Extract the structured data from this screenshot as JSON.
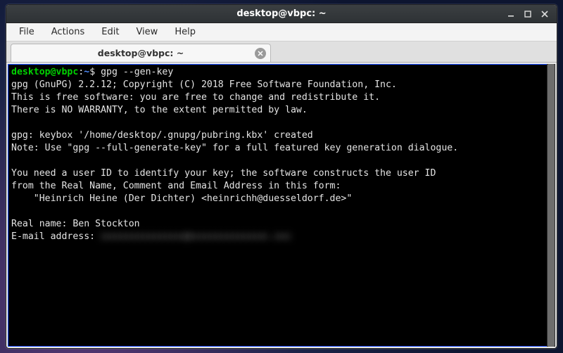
{
  "window": {
    "title": "desktop@vbpc: ~"
  },
  "menubar": {
    "items": [
      "File",
      "Actions",
      "Edit",
      "View",
      "Help"
    ]
  },
  "tab": {
    "label": "desktop@vbpc: ~"
  },
  "prompt": {
    "user_host": "desktop@vbpc",
    "colon": ":",
    "path": "~",
    "dollar": "$"
  },
  "terminal": {
    "command": " gpg --gen-key",
    "line1": "gpg (GnuPG) 2.2.12; Copyright (C) 2018 Free Software Foundation, Inc.",
    "line2": "This is free software: you are free to change and redistribute it.",
    "line3": "There is NO WARRANTY, to the extent permitted by law.",
    "blank1": "",
    "line4": "gpg: keybox '/home/desktop/.gnupg/pubring.kbx' created",
    "line5": "Note: Use \"gpg --full-generate-key\" for a full featured key generation dialogue.",
    "blank2": "",
    "line6": "You need a user ID to identify your key; the software constructs the user ID",
    "line7": "from the Real Name, Comment and Email Address in this form:",
    "line8": "    \"Heinrich Heine (Der Dichter) <heinrichh@duesseldorf.de>\"",
    "blank3": "",
    "line9": "Real name: Ben Stockton",
    "line10_label": "E-mail address: ",
    "line10_value_redacted": "xxxxxxxxxxxxxxx@xxxxxxxxxxxxxx.xxx"
  }
}
